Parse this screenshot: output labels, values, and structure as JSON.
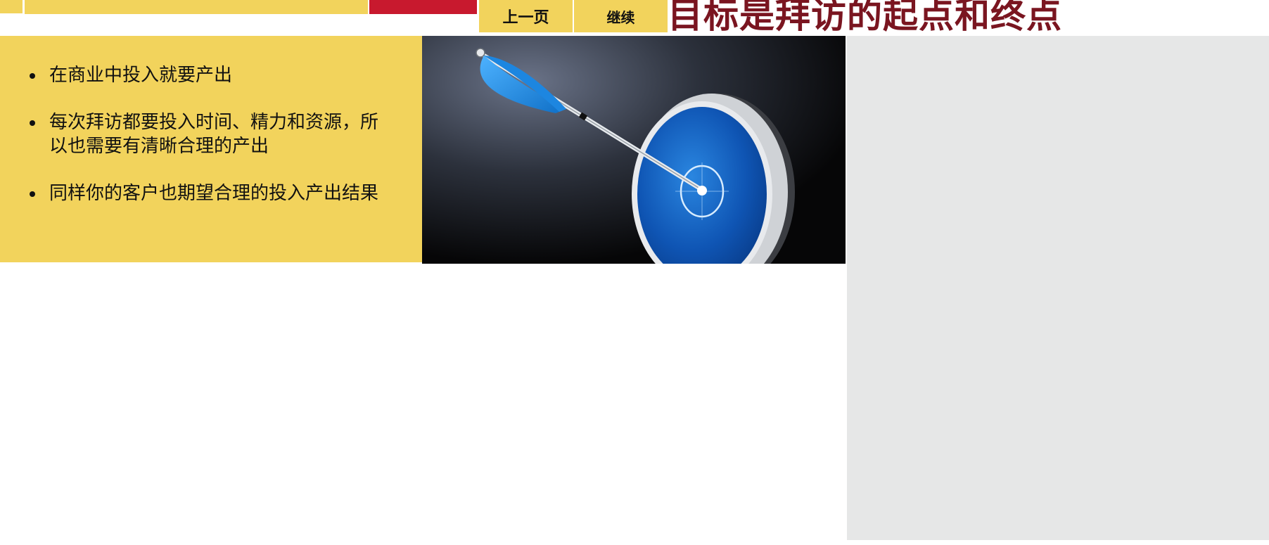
{
  "nav": {
    "prev_label": "上一页",
    "next_label": "继续"
  },
  "page": {
    "title": "目标是拜访的起点和终点"
  },
  "content": {
    "bullets": [
      "在商业中投入就要产出",
      "每次拜访都要投入时间、精力和资源，所以也需要有清晰合理的产出",
      "同样你的客户也期望合理的投入产出结果"
    ]
  },
  "colors": {
    "accent_yellow": "#f2d35c",
    "accent_red": "#c8192e",
    "title_maroon": "#7a1520",
    "side_panel_gray": "#e6e7e7"
  },
  "image": {
    "icon": "arrow-in-target-icon"
  }
}
